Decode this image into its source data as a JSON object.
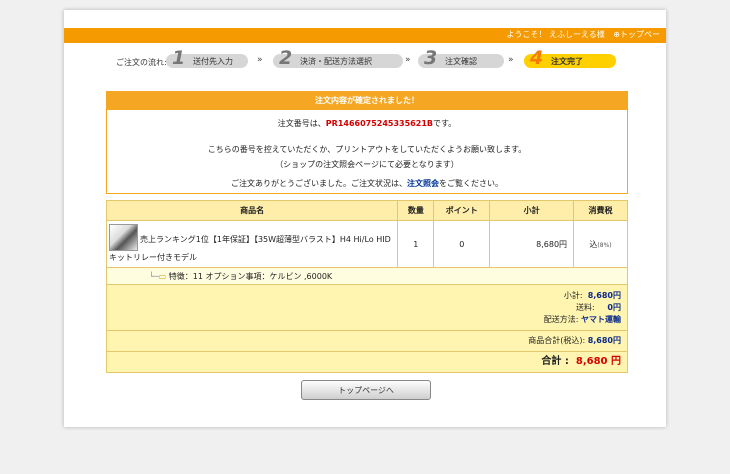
{
  "header": {
    "welcome": "ようこそ！ えふしーえる様",
    "top_link": "トップペー"
  },
  "steps": {
    "label": "ご注文の流れ:",
    "items": [
      {
        "num": "1",
        "label": "送付先入力"
      },
      {
        "num": "2",
        "label": "決済・配送方法選択"
      },
      {
        "num": "3",
        "label": "注文確認"
      },
      {
        "num": "4",
        "label": "注文完了"
      }
    ],
    "separator": "»"
  },
  "confirmation": {
    "header": "注文内容が確定されました！",
    "order_prefix": "注文番号は、",
    "order_number": "PR1466075245335621B",
    "order_suffix": "です。",
    "note1": "こちらの番号を控えていただくか、プリントアウトをしていただくようお願い致します。",
    "note2": "（ショップの注文照会ページにて必要となります）",
    "thanks_prefix": "ご注文ありがとうございました。ご注文状況は、",
    "thanks_link": "注文照会",
    "thanks_suffix": "をご覧ください。"
  },
  "table": {
    "headers": [
      "商品名",
      "数量",
      "ポイント",
      "小計",
      "消費税"
    ],
    "item": {
      "name": "売上ランキング1位【1年保証】【35W超薄型バラスト】H4 Hi/Lo HID キットリレー付きモデル",
      "qty": "1",
      "points": "0",
      "subtotal": "8,680円",
      "tax": "込",
      "tax_rate": "(8%)"
    },
    "option": "特徴：11 オプション事項：ケルビン ,6000K",
    "summary": {
      "subtotal_label": "小計:",
      "subtotal_value": "8,680円",
      "shipping_label": "送料:",
      "shipping_value": "0円",
      "delivery_label": "配送方法:",
      "delivery_value": "ヤマト運輸"
    }
  },
  "totals": {
    "incl_label": "商品合計(税込):",
    "incl_value": "8,680円",
    "total_label": "合計 :",
    "total_value": "8,680 円"
  },
  "button": {
    "top_page": "トップページへ"
  }
}
